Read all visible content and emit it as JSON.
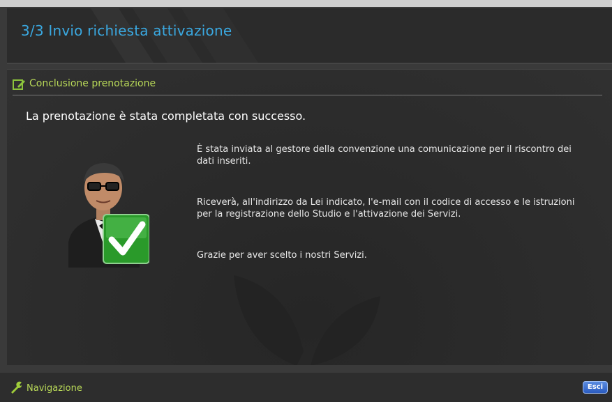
{
  "header": {
    "title": "3/3 Invio richiesta attivazione"
  },
  "section": {
    "title": "Conclusione prenotazione"
  },
  "main": {
    "headline": "La prenotazione è stata completata con successo.",
    "paragraph1": "È stata inviata al gestore della convenzione una comunicazione per il riscontro dei dati inseriti.",
    "paragraph2": "Riceverà, all'indirizzo da Lei indicato, l'e-mail con il codice di accesso e le istruzioni per la registrazione dello Studio e l'attivazione dei Servizi.",
    "paragraph3": "Grazie per aver scelto i nostri Servizi."
  },
  "footer": {
    "title": "Navigazione",
    "exit_label": "Esci"
  },
  "icons": {
    "section": "edit-icon",
    "illustration": "user-check-icon",
    "footer": "wrench-icon"
  },
  "colors": {
    "title_blue": "#3aa8e0",
    "label_green": "#b8d858",
    "exit_button": "#2a5bc0"
  }
}
